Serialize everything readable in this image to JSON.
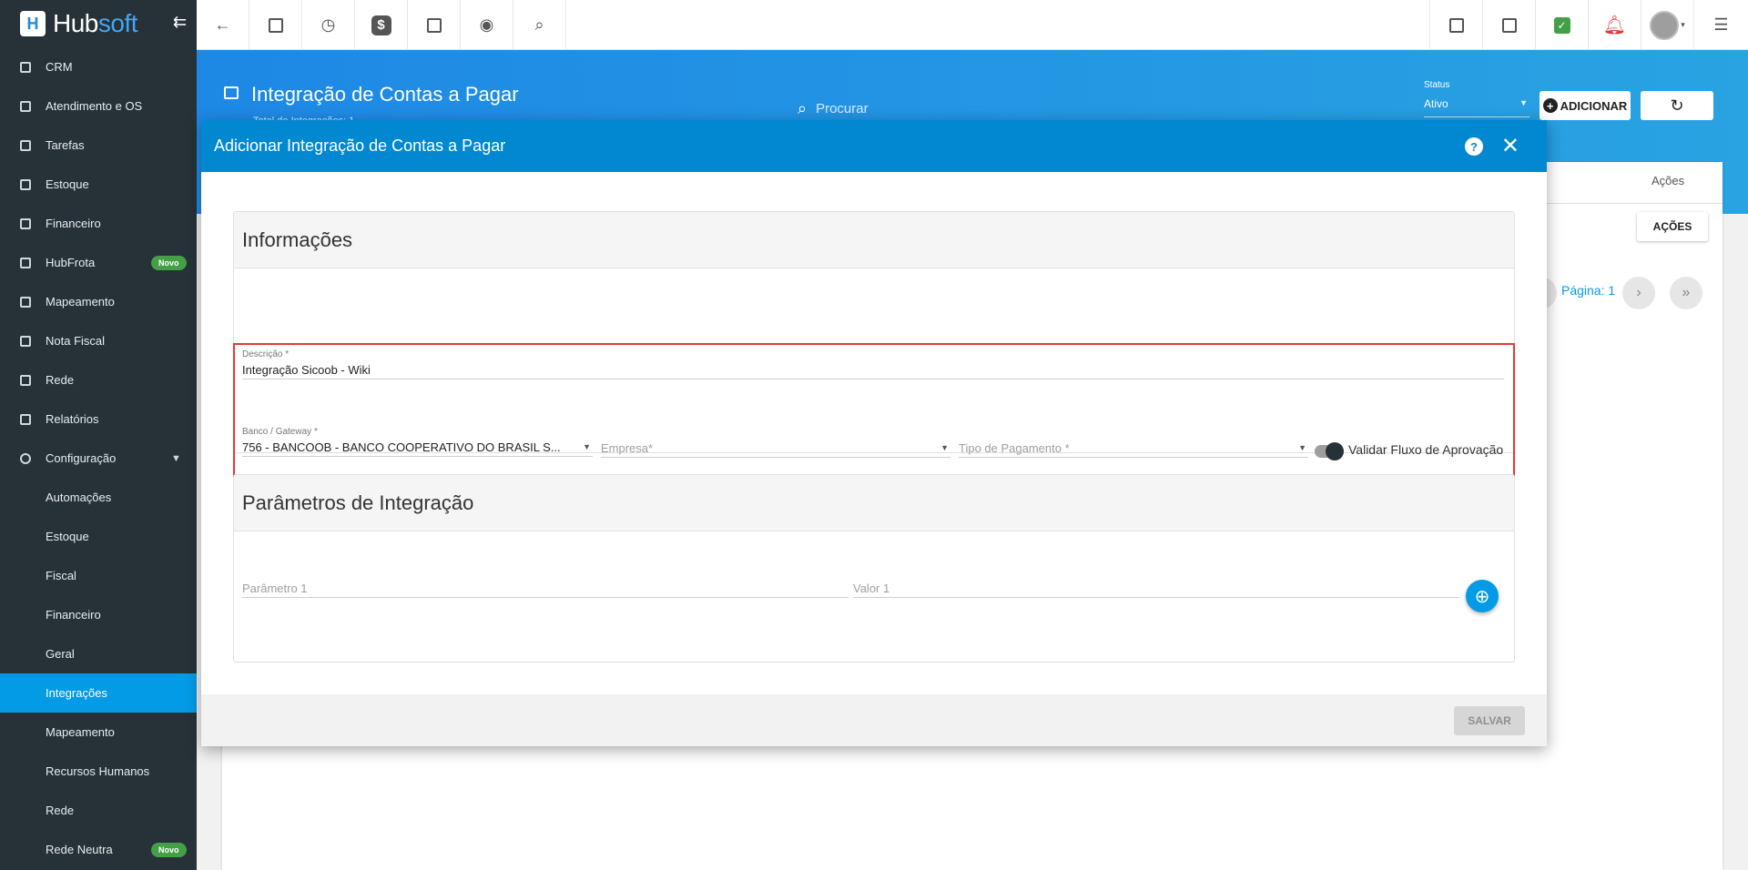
{
  "app": {
    "brand_prefix": "Hub",
    "brand_suffix": "soft",
    "logo_letter": "H"
  },
  "sidebar": {
    "items": [
      {
        "label": "CRM",
        "icon": "crm-icon"
      },
      {
        "label": "Atendimento e OS",
        "icon": "support-icon"
      },
      {
        "label": "Tarefas",
        "icon": "tasks-icon"
      },
      {
        "label": "Estoque",
        "icon": "stock-icon"
      },
      {
        "label": "Financeiro",
        "icon": "finance-icon"
      },
      {
        "label": "HubFrota",
        "icon": "car-icon",
        "badge": "Novo"
      },
      {
        "label": "Mapeamento",
        "icon": "map-pin-icon"
      },
      {
        "label": "Nota Fiscal",
        "icon": "invoice-icon"
      },
      {
        "label": "Rede",
        "icon": "network-icon"
      },
      {
        "label": "Relatórios",
        "icon": "report-icon"
      },
      {
        "label": "Configuração",
        "icon": "gear-icon"
      }
    ],
    "subitems": [
      {
        "label": "Automações"
      },
      {
        "label": "Estoque"
      },
      {
        "label": "Fiscal"
      },
      {
        "label": "Financeiro"
      },
      {
        "label": "Geral"
      },
      {
        "label": "Integrações",
        "active": true
      },
      {
        "label": "Mapeamento"
      },
      {
        "label": "Recursos Humanos"
      },
      {
        "label": "Rede"
      },
      {
        "label": "Rede Neutra",
        "badge": "Novo"
      }
    ]
  },
  "topbar": {
    "left_icons": [
      "back-arrow-icon",
      "contact-card-icon",
      "calendar-clock-icon",
      "dollar-icon",
      "terminal-icon",
      "eye-icon",
      "search-icon"
    ],
    "right_icons": [
      "pdf-icon",
      "building-icon",
      "check-badge-icon",
      "alarm-bell-icon",
      "user-avatar",
      "list-icon"
    ],
    "dollar_symbol": "$"
  },
  "header": {
    "title": "Integração de Contas a Pagar",
    "subtitle": "Total de Integrações: 1",
    "search_placeholder": "Procurar",
    "status_label": "Status",
    "status_value": "Ativo",
    "add_button": "ADICIONAR",
    "plus_symbol": "+"
  },
  "background": {
    "column_acoes": "Ações",
    "acoes_button": "AÇÕES",
    "pagina_text": "Página: 1"
  },
  "modal": {
    "title": "Adicionar Integração de Contas a Pagar",
    "help_symbol": "?",
    "close_symbol": "✕",
    "section_info": "Informações",
    "descricao_label": "Descrição",
    "descricao_value": "Integração Sicoob - Wiki",
    "banco_label": "Banco / Gateway",
    "banco_value": "756 - BANCOOB - BANCO COOPERATIVO DO BRASIL S...",
    "empresa_placeholder": "Empresa",
    "tipo_placeholder": "Tipo de Pagamento",
    "required_mark": "*",
    "toggle_label": "Validar Fluxo de Aprovação",
    "toggle_on": true,
    "section_params": "Parâmetros de Integração",
    "param_placeholder": "Parâmetro 1",
    "valor_placeholder": "Valor 1",
    "save_button": "SALVAR"
  },
  "colors": {
    "sidebar_bg": "#263238",
    "accent": "#039be5",
    "modal_header": "#0288d1",
    "highlight_border": "#e53935",
    "badge_green": "#43a047"
  }
}
